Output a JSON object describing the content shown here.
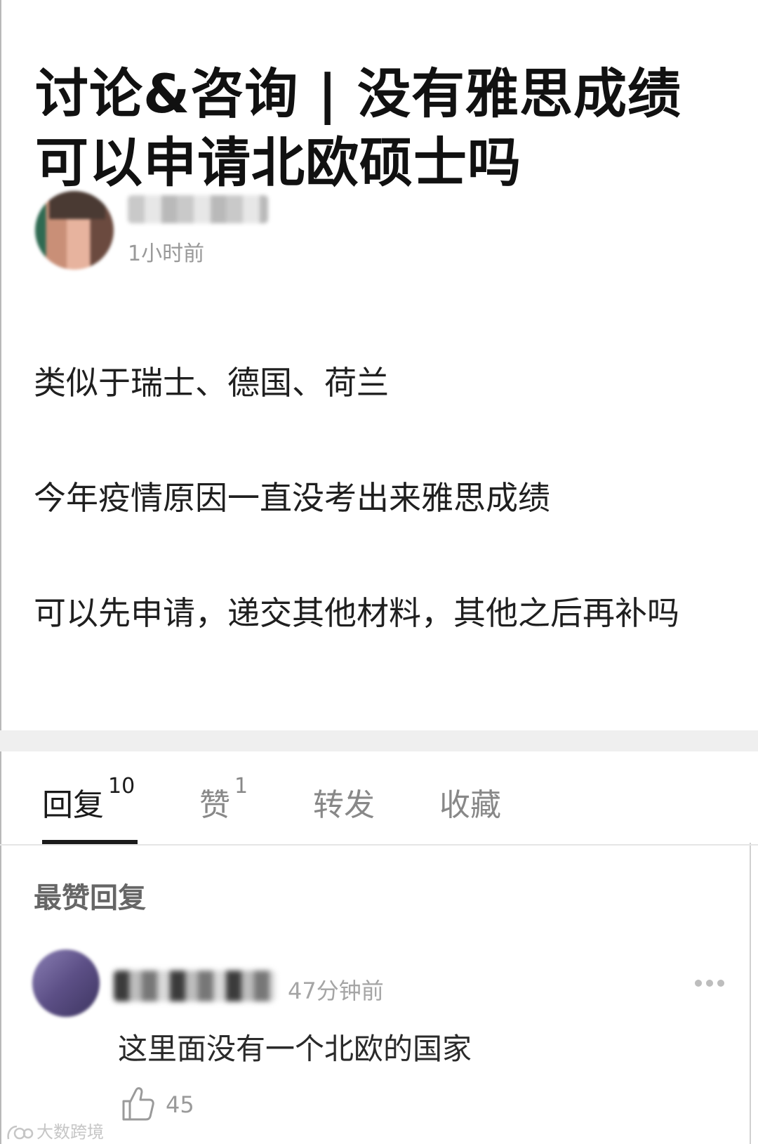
{
  "post": {
    "title": "讨论&咨询 | 没有雅思成绩可以申请北欧硕士吗",
    "author": {
      "name": "",
      "time": "1小时前"
    },
    "paragraphs": [
      "类似于瑞士、德国、荷兰",
      "今年疫情原因一直没考出来雅思成绩",
      "可以先申请，递交其他材料，其他之后再补吗"
    ]
  },
  "tabs": [
    {
      "label": "回复",
      "count": "10"
    },
    {
      "label": "赞",
      "count": "1"
    },
    {
      "label": "转发",
      "count": ""
    },
    {
      "label": "收藏",
      "count": ""
    }
  ],
  "replies_section": {
    "title": "最赞回复",
    "replies": [
      {
        "name": "",
        "time": "47分钟前",
        "text": "这里面没有一个北欧的国家",
        "likes": "45"
      }
    ]
  },
  "watermark": {
    "text": "大数跨境"
  },
  "icons": {
    "more": "more-dots-icon",
    "like": "thumbs-up-icon",
    "watermark_logo": "watermark-logo-icon"
  },
  "colors": {
    "text_primary": "#1a1a1a",
    "text_muted": "#999999",
    "divider": "#efefef",
    "tab_active": "#1a1a1a"
  }
}
